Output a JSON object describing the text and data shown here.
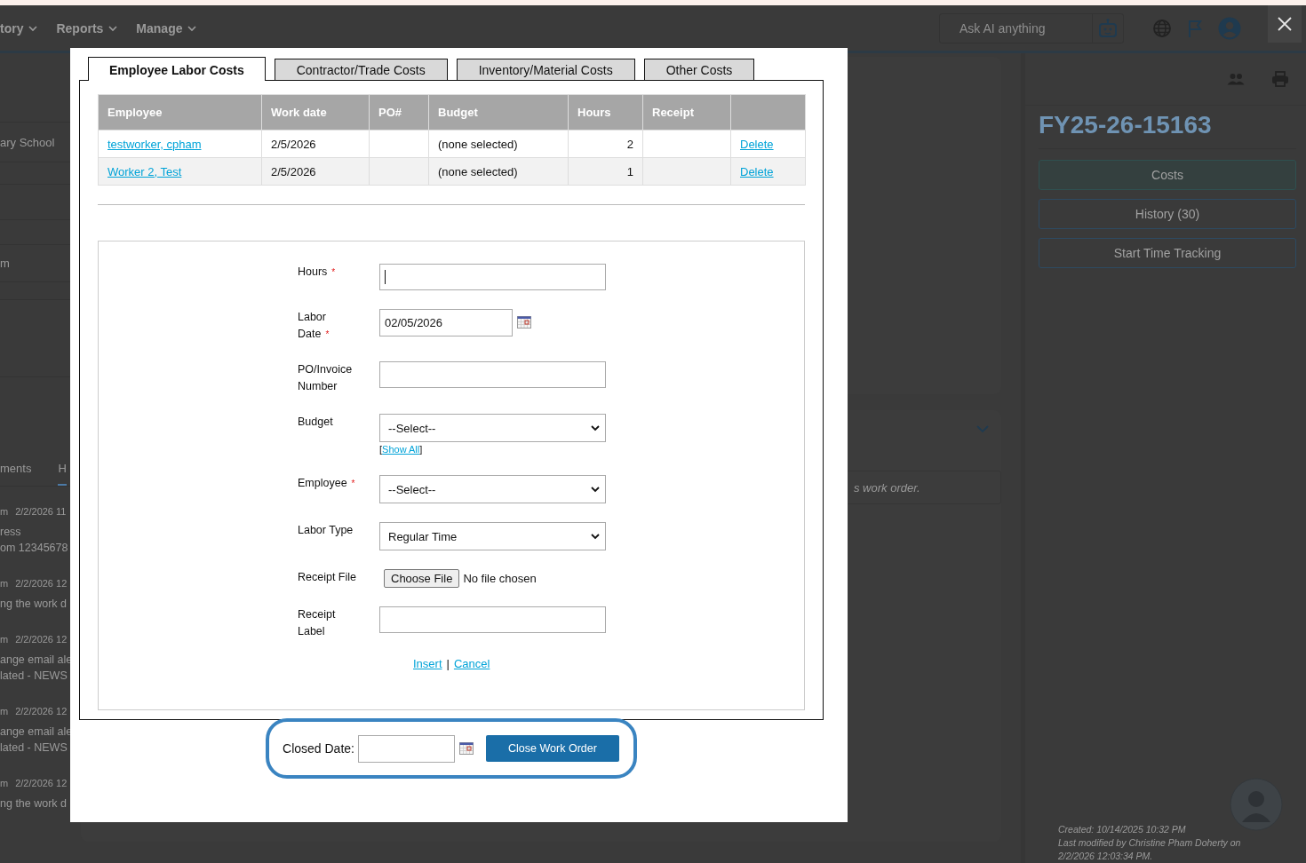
{
  "header": {
    "nav": [
      {
        "label": "tory"
      },
      {
        "label": "Reports"
      },
      {
        "label": "Manage"
      }
    ],
    "ai_search": {
      "placeholder": "Ask AI anything"
    }
  },
  "left_panel": {
    "items": [
      "ary School",
      "m"
    ],
    "tabs": [
      {
        "label": "ments",
        "selected": false
      },
      {
        "label": "H",
        "selected": true
      }
    ],
    "activity": [
      {
        "user": "m",
        "time": "2/2/2026 11",
        "lines": [
          "ress",
          "om 12345678"
        ]
      },
      {
        "user": "m",
        "time": "2/2/2026 12",
        "lines": [
          "ng the work d"
        ]
      },
      {
        "user": "m",
        "time": "2/2/2026 12",
        "lines": [
          "ange email ale",
          "lated - NEWS"
        ]
      },
      {
        "user": "m",
        "time": "2/2/2026 12",
        "lines": [
          "ange email ale",
          "lated - NEWS"
        ]
      },
      {
        "user": "m",
        "time": "2/2/2026 12",
        "lines": [
          "ng the work d"
        ]
      }
    ]
  },
  "notice": {
    "text": "s work order."
  },
  "side_panel": {
    "title": "FY25-26-15163",
    "buttons": [
      {
        "label": "Costs",
        "selected": true
      },
      {
        "label": "History (30)",
        "selected": false
      },
      {
        "label": "Start Time Tracking",
        "selected": false
      }
    ],
    "created": "Created: 10/14/2025 10:32 PM",
    "modified": "Last modified by Christine Pham Doherty on 2/2/2026 12:03:34 PM."
  },
  "modal": {
    "tabs": [
      {
        "label": "Employee Labor Costs",
        "selected": true
      },
      {
        "label": "Contractor/Trade Costs",
        "selected": false
      },
      {
        "label": "Inventory/Material Costs",
        "selected": false
      },
      {
        "label": "Other Costs",
        "selected": false
      }
    ],
    "table": {
      "columns": [
        "Employee",
        "Work date",
        "PO#",
        "Budget",
        "Hours",
        "Receipt"
      ],
      "rows": [
        {
          "employee": "testworker, cpham",
          "work_date": "2/5/2026",
          "budget": "(none selected)",
          "hours": "2",
          "action": "Delete"
        },
        {
          "employee": "Worker 2, Test",
          "work_date": "2/5/2026",
          "budget": "(none selected)",
          "hours": "1",
          "action": "Delete"
        }
      ]
    },
    "form": {
      "fields": [
        {
          "kind": "text",
          "label": "Hours",
          "required": true,
          "focused": true
        },
        {
          "kind": "date",
          "label": "Labor Date",
          "required": true,
          "value": "02/05/2026"
        },
        {
          "kind": "text",
          "label": "PO/Invoice Number",
          "required": false
        },
        {
          "kind": "select",
          "label": "Budget",
          "required": false,
          "value": "--Select--",
          "link": {
            "before": "[",
            "text": "Show All",
            "after": "]"
          }
        },
        {
          "kind": "select",
          "label": "Employee",
          "required": true,
          "value": "--Select--"
        },
        {
          "kind": "select",
          "label": "Labor Type",
          "required": false,
          "value": "Regular Time"
        },
        {
          "kind": "file",
          "label": "Receipt File",
          "required": false,
          "button": "Choose File",
          "status": "No file chosen"
        },
        {
          "kind": "text",
          "label": "Receipt Label",
          "required": false
        }
      ],
      "actions": [
        "Insert",
        "Cancel"
      ],
      "separator": "|",
      "required_mark": "*"
    },
    "close_bar": {
      "label": "Closed Date:",
      "button": "Close Work Order",
      "highlighted": true
    }
  }
}
